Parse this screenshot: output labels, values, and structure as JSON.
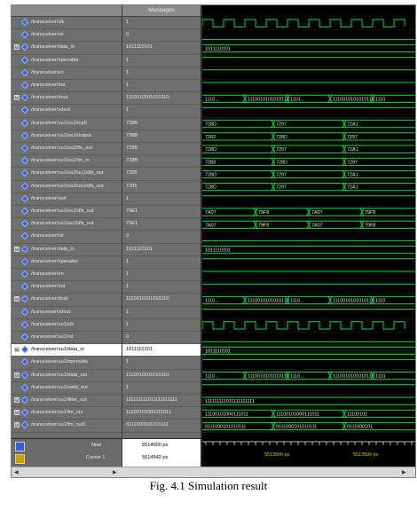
{
  "header": {
    "messages_label": "Messages"
  },
  "signals": [
    {
      "name": "/transceiver/clk",
      "value": "1",
      "expandable": false,
      "wave": "clock",
      "labels": []
    },
    {
      "name": "/transceiver/rst",
      "value": "0",
      "expandable": false,
      "wave": "low",
      "labels": []
    },
    {
      "name": "/transceiver/data_in",
      "value": "1011110101",
      "expandable": true,
      "wave": "bus",
      "labels": [
        "1011110101"
      ]
    },
    {
      "name": "/transceiver/npenable",
      "value": "1",
      "expandable": false,
      "wave": "high",
      "labels": []
    },
    {
      "name": "/transceiver/en",
      "value": "1",
      "expandable": false,
      "wave": "high",
      "labels": []
    },
    {
      "name": "/transceiver/out",
      "value": "1",
      "expandable": false,
      "wave": "high",
      "labels": []
    },
    {
      "name": "/transceiver/dout",
      "value": "1110010101010110",
      "expandable": true,
      "wave": "bus",
      "labels": [
        "1110...",
        "1110010101010110",
        "1110...",
        "1110010101010110",
        "1110"
      ]
    },
    {
      "name": "/transceiver/vdout",
      "value": "1",
      "expandable": false,
      "wave": "high",
      "labels": []
    },
    {
      "name": "/transceiver/uu1/uu1/inp0",
      "value": "728B",
      "expandable": false,
      "wave": "bus",
      "labels": [
        "728D",
        "7297",
        "72A1"
      ]
    },
    {
      "name": "/transceiver/uu1/uu1/output",
      "value": "728B",
      "expandable": false,
      "wave": "bus",
      "labels": [
        "7283",
        "728D",
        "7297"
      ]
    },
    {
      "name": "/transceiver/uu1/uu2/fin_out",
      "value": "728B",
      "expandable": false,
      "wave": "bus",
      "labels": [
        "728D",
        "7297",
        "72A1"
      ]
    },
    {
      "name": "/transceiver/uu1/uu2/fin_in",
      "value": "728B",
      "expandable": false,
      "wave": "bus",
      "labels": [
        "7283",
        "728D",
        "7297"
      ]
    },
    {
      "name": "/transceiver/uu1/uu2/uu1/dfs_out",
      "value": "7205",
      "expandable": false,
      "wave": "bus",
      "labels": [
        "728D",
        "7297",
        "72A1"
      ]
    },
    {
      "name": "/transceiver/uu1/uu2/uu1/dfs_out",
      "value": "7205",
      "expandable": false,
      "wave": "bus",
      "labels": [
        "728D",
        "7297",
        "72A1"
      ]
    },
    {
      "name": "/transceiver/uu4",
      "value": "1",
      "expandable": false,
      "wave": "high",
      "labels": []
    },
    {
      "name": "/transceiver/uu1/uu1/dfs_out",
      "value": "79E1",
      "expandable": false,
      "wave": "bus",
      "labels": [
        "7A07",
        "79F8",
        "7A07",
        "79F8"
      ]
    },
    {
      "name": "/transceiver/uu1/uu2/dfs_out",
      "value": "79E1",
      "expandable": false,
      "wave": "bus",
      "labels": [
        "7A07",
        "79F8",
        "7A07",
        "79F8"
      ]
    },
    {
      "name": "/transceiver/rst",
      "value": "0",
      "expandable": false,
      "wave": "low",
      "labels": []
    },
    {
      "name": "/transceiver/data_in",
      "value": "1011110101",
      "expandable": true,
      "wave": "bus",
      "labels": [
        "1011110101"
      ]
    },
    {
      "name": "/transceiver/npenable",
      "value": "1",
      "expandable": false,
      "wave": "high",
      "labels": []
    },
    {
      "name": "/transceiver/en",
      "value": "1",
      "expandable": false,
      "wave": "high",
      "labels": []
    },
    {
      "name": "/transceiver/out",
      "value": "1",
      "expandable": false,
      "wave": "high",
      "labels": []
    },
    {
      "name": "/transceiver/dout",
      "value": "1110010101010110",
      "expandable": true,
      "wave": "bus",
      "labels": [
        "1110...",
        "1110010101010110",
        "1110...",
        "1110010101010110",
        "1110"
      ]
    },
    {
      "name": "/transceiver/vdout",
      "value": "1",
      "expandable": false,
      "wave": "high",
      "labels": []
    },
    {
      "name": "/transceiver/uu1/clk",
      "value": "1",
      "expandable": false,
      "wave": "clock",
      "labels": []
    },
    {
      "name": "/transceiver/uu1/rst",
      "value": "0",
      "expandable": false,
      "wave": "low",
      "labels": []
    },
    {
      "name": "/transceiver/uu1/data_in",
      "value": "1011110101",
      "expandable": true,
      "wave": "bus",
      "labels": [
        "1011110101"
      ],
      "highlight": true
    },
    {
      "name": "/transceiver/uu1/npenable",
      "value": "1",
      "expandable": false,
      "wave": "high",
      "labels": []
    },
    {
      "name": "/transceiver/uu1/data_out",
      "value": "1110010101010110",
      "expandable": true,
      "wave": "bus",
      "labels": [
        "1110...",
        "1110010101010110",
        "1110...",
        "1110010101010110",
        "1110"
      ]
    },
    {
      "name": "/transceiver/uu1/valid_out",
      "value": "1",
      "expandable": false,
      "wave": "high",
      "labels": []
    },
    {
      "name": "/transceiver/uu1/filter_out",
      "value": "111111111011111111111",
      "expandable": true,
      "wave": "bus",
      "labels": [
        "111111111011111111111"
      ]
    },
    {
      "name": "/transceiver/uu1/fm_out",
      "value": "11100101000111011",
      "expandable": true,
      "wave": "bus",
      "labels": [
        "11100101000111011",
        "11100101000111011",
        "11100101"
      ]
    },
    {
      "name": "/transceiver/uu1/fm_out1",
      "value": "0111000101010111",
      "expandable": true,
      "wave": "bus",
      "labels": [
        "0111000101010111",
        "0111000101010111",
        "0111000101"
      ]
    }
  ],
  "status": {
    "now_label": "Now",
    "now_value": "5514600 ps",
    "cursor_label": "Cursor 1",
    "cursor_value": "5514549 ps",
    "time_ticks": [
      "5513500 ps",
      "5513500 ps"
    ]
  },
  "caption": "Fig. 4.1 Simulation result",
  "colors": {
    "wave_green": "#00e040",
    "text_light": "#e8e8e8",
    "pane_gray": "#6e6e6e",
    "wave_bg": "#000000"
  }
}
